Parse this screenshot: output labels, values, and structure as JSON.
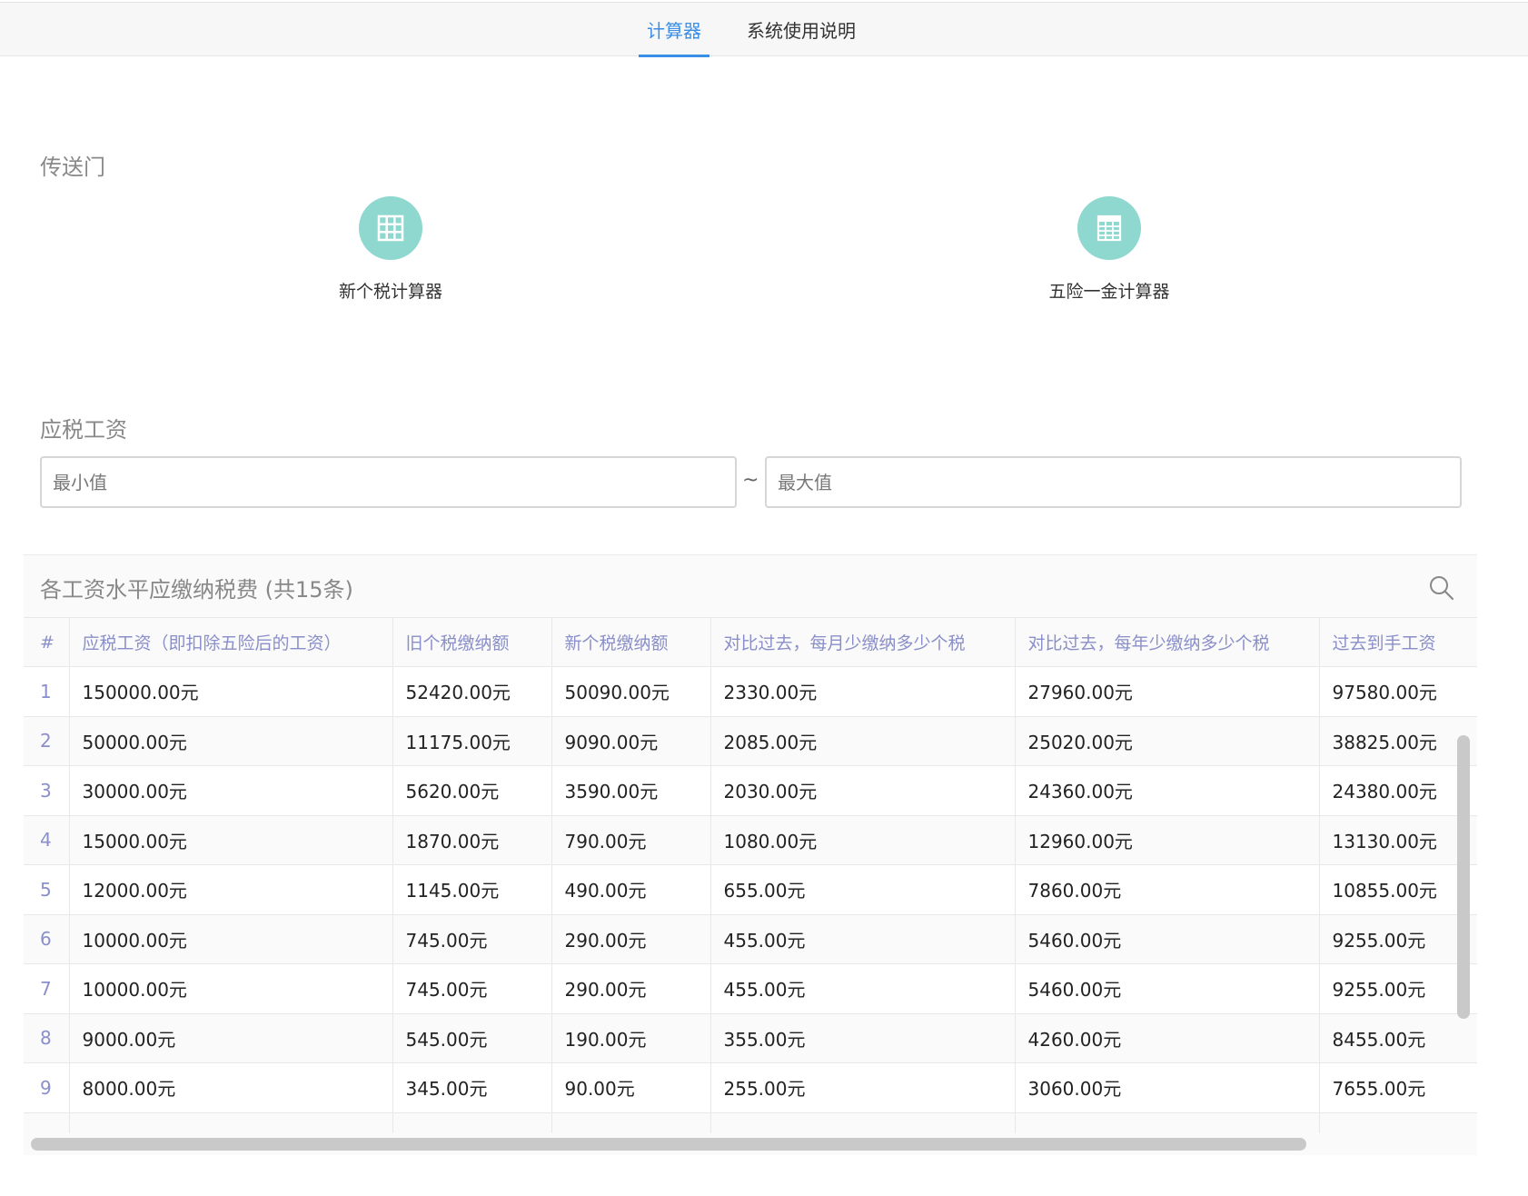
{
  "tabs": [
    {
      "label": "计算器",
      "active": true
    },
    {
      "label": "系统使用说明",
      "active": false
    }
  ],
  "portal": {
    "title": "传送门",
    "items": [
      {
        "label": "新个税计算器",
        "icon": "grid-icon"
      },
      {
        "label": "五险一金计算器",
        "icon": "spreadsheet-icon"
      }
    ]
  },
  "filter": {
    "title": "应税工资",
    "min_placeholder": "最小值",
    "separator": "~",
    "max_placeholder": "最大值"
  },
  "table": {
    "title": "各工资水平应缴纳税费 (共15条)",
    "columns": [
      "#",
      "应税工资（即扣除五险后的工资）",
      "旧个税缴纳额",
      "新个税缴纳额",
      "对比过去，每月少缴纳多少个税",
      "对比过去，每年少缴纳多少个税",
      "过去到手工资"
    ],
    "rows": [
      [
        "1",
        "150000.00元",
        "52420.00元",
        "50090.00元",
        "2330.00元",
        "27960.00元",
        "97580.00元"
      ],
      [
        "2",
        "50000.00元",
        "11175.00元",
        "9090.00元",
        "2085.00元",
        "25020.00元",
        "38825.00元"
      ],
      [
        "3",
        "30000.00元",
        "5620.00元",
        "3590.00元",
        "2030.00元",
        "24360.00元",
        "24380.00元"
      ],
      [
        "4",
        "15000.00元",
        "1870.00元",
        "790.00元",
        "1080.00元",
        "12960.00元",
        "13130.00元"
      ],
      [
        "5",
        "12000.00元",
        "1145.00元",
        "490.00元",
        "655.00元",
        "7860.00元",
        "10855.00元"
      ],
      [
        "6",
        "10000.00元",
        "745.00元",
        "290.00元",
        "455.00元",
        "5460.00元",
        "9255.00元"
      ],
      [
        "7",
        "10000.00元",
        "745.00元",
        "290.00元",
        "455.00元",
        "5460.00元",
        "9255.00元"
      ],
      [
        "8",
        "9000.00元",
        "545.00元",
        "190.00元",
        "355.00元",
        "4260.00元",
        "8455.00元"
      ],
      [
        "9",
        "8000.00元",
        "345.00元",
        "90.00元",
        "255.00元",
        "3060.00元",
        "7655.00元"
      ],
      [
        "",
        "",
        "",
        "",
        "",
        "",
        ""
      ]
    ]
  },
  "colors": {
    "accent": "#3a8ee6",
    "icon_bg": "#8fd8cf",
    "header_text": "#8a8fc9"
  }
}
